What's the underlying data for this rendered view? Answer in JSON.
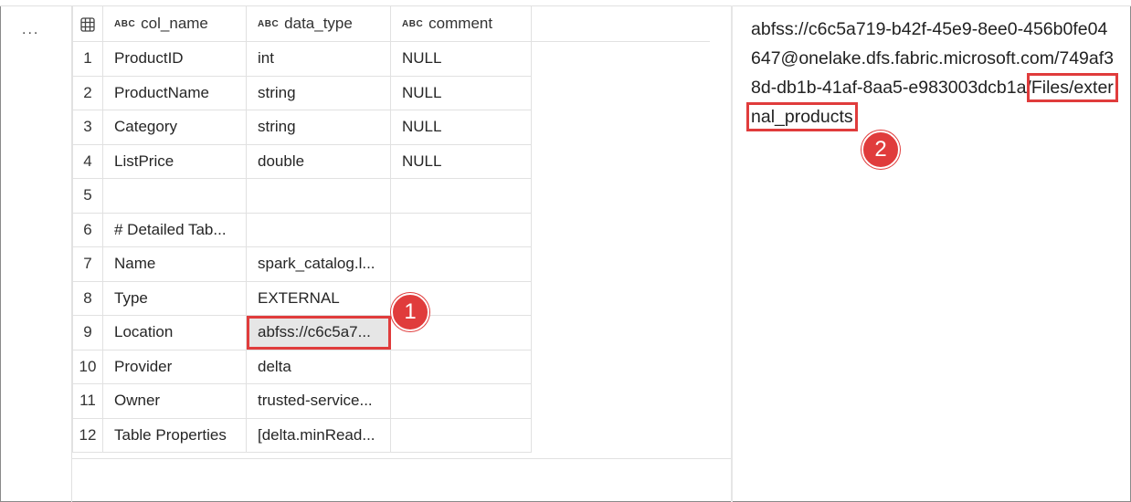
{
  "cell_menu": "...",
  "grid": {
    "columns": [
      {
        "type_tag": "ABC",
        "name": "col_name"
      },
      {
        "type_tag": "ABC",
        "name": "data_type"
      },
      {
        "type_tag": "ABC",
        "name": "comment"
      }
    ],
    "rows": [
      {
        "n": "1",
        "col_name": "ProductID",
        "data_type": "int",
        "comment": "NULL"
      },
      {
        "n": "2",
        "col_name": "ProductName",
        "data_type": "string",
        "comment": "NULL"
      },
      {
        "n": "3",
        "col_name": "Category",
        "data_type": "string",
        "comment": "NULL"
      },
      {
        "n": "4",
        "col_name": "ListPrice",
        "data_type": "double",
        "comment": "NULL"
      },
      {
        "n": "5",
        "col_name": "",
        "data_type": "",
        "comment": ""
      },
      {
        "n": "6",
        "col_name": "# Detailed Tab...",
        "data_type": "",
        "comment": ""
      },
      {
        "n": "7",
        "col_name": "Name",
        "data_type": "spark_catalog.l...",
        "comment": ""
      },
      {
        "n": "8",
        "col_name": "Type",
        "data_type": "EXTERNAL",
        "comment": ""
      },
      {
        "n": "9",
        "col_name": "Location",
        "data_type": "abfss://c6c5a7...",
        "comment": ""
      },
      {
        "n": "10",
        "col_name": "Provider",
        "data_type": "delta",
        "comment": ""
      },
      {
        "n": "11",
        "col_name": "Owner",
        "data_type": "trusted-service...",
        "comment": ""
      },
      {
        "n": "12",
        "col_name": "Table Properties",
        "data_type": "[delta.minRead...",
        "comment": ""
      }
    ]
  },
  "detail": {
    "path_prefix": "abfss://c6c5a719-b42f-45e9-8ee0-456b0fe04647@onelake.dfs.fabric.microsoft.com/749af38d-db1b-41af-8aa5-e983003dcb1a/",
    "path_highlight": "Files/external_products"
  },
  "annotations": {
    "badge1": "1",
    "badge2": "2",
    "color": "#e03c3c"
  }
}
